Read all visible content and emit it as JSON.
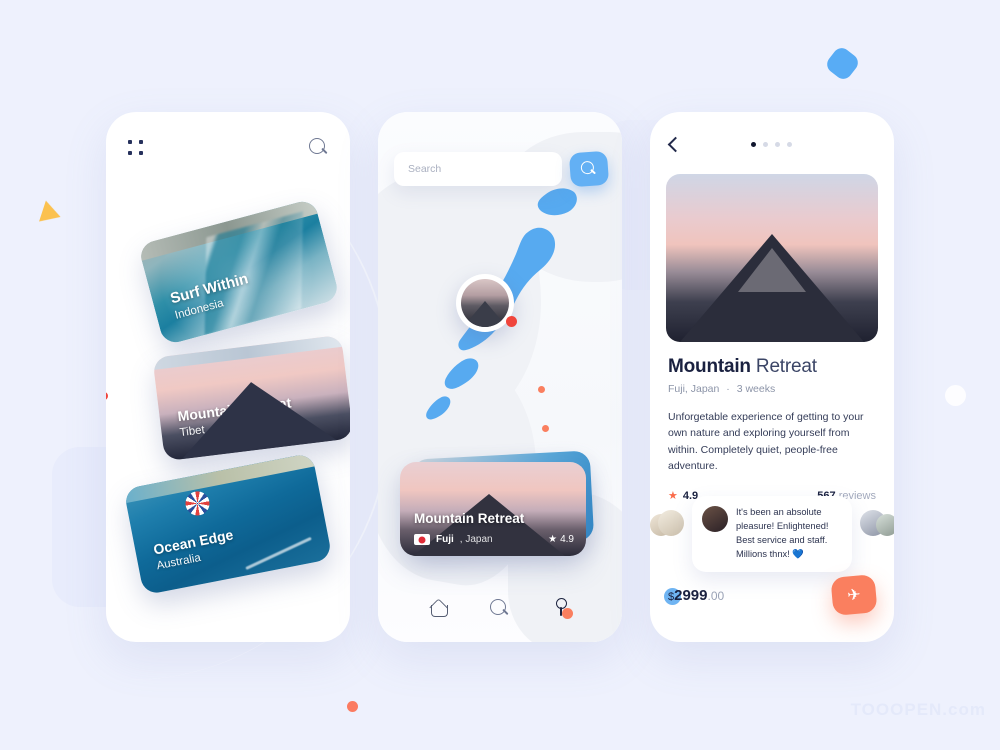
{
  "colors": {
    "background": "#eef1fd",
    "accent_blue": "#63b0f4",
    "accent_orange": "#fa7f5f",
    "accent_red": "#f0453c",
    "accent_yellow": "#fbc14f",
    "text_dark": "#1a2140"
  },
  "watermark": "TOOOPEN.com",
  "screen1": {
    "grid_icon": "grid-icon",
    "search_icon": "search-icon",
    "cards": [
      {
        "title": "Surf Within",
        "subtitle": "Indonesia"
      },
      {
        "title": "Mountain Retreat",
        "subtitle": "Tibet"
      },
      {
        "title": "Ocean Edge",
        "subtitle": "Australia"
      }
    ]
  },
  "screen2": {
    "search": {
      "placeholder": "Search",
      "value": "",
      "button_icon": "search-icon"
    },
    "map": {
      "marker_icon": "photo-marker",
      "pins": 3
    },
    "place_card": {
      "title": "Mountain Retreat",
      "flag": "jp-flag",
      "city": "Fuji",
      "country": ", Japan",
      "rating_star": "★",
      "rating": "4.9"
    },
    "tabbar": [
      {
        "name": "home",
        "icon": "home-icon",
        "active": false
      },
      {
        "name": "search",
        "icon": "search-icon",
        "active": false
      },
      {
        "name": "places",
        "icon": "location-pin-icon",
        "active": true
      }
    ]
  },
  "screen3": {
    "back_icon": "chevron-left-icon",
    "dots": {
      "total": 4,
      "active": 1
    },
    "hero_image": "mountain-photo",
    "title_bold": "Mountain",
    "title_regular": "Retreat",
    "location": "Fuji, Japan",
    "separator": "·",
    "duration": "3 weeks",
    "description": "Unforgetable experience of getting to your own nature and exploring yourself from within. Completely quiet, people-free adventure.",
    "rating": {
      "star": "★",
      "score": "4.9",
      "reviews_count": "567",
      "reviews_label": " reviews"
    },
    "testimonial": {
      "text": "It's been an absolute pleasure! Enlightened! Best service and staff. Millions thnx! ",
      "emoji": "💙"
    },
    "price": {
      "currency": "$",
      "amount": "2999",
      "cents": ".00"
    },
    "book_button_icon": "airplane-icon",
    "book_button_glyph": "✈"
  }
}
